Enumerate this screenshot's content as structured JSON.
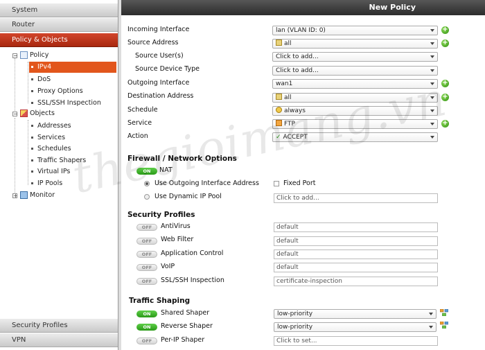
{
  "sidebar": {
    "headers": [
      "System",
      "Router",
      "Policy & Objects"
    ],
    "footer": [
      "Security Profiles",
      "VPN"
    ],
    "tree": {
      "policy": "Policy",
      "ipv4": "IPv4",
      "dos": "DoS",
      "proxy_options": "Proxy Options",
      "ssl_ssh": "SSL/SSH Inspection",
      "objects": "Objects",
      "addresses": "Addresses",
      "services": "Services",
      "schedules": "Schedules",
      "traffic_shapers": "Traffic Shapers",
      "virtual_ips": "Virtual IPs",
      "ip_pools": "IP Pools",
      "monitor": "Monitor"
    }
  },
  "main": {
    "title": "New Policy",
    "fields": {
      "incoming_interface": {
        "label": "Incoming Interface",
        "value": "lan (VLAN ID: 0)"
      },
      "source_address": {
        "label": "Source Address",
        "value": "all"
      },
      "source_users": {
        "label": "Source User(s)",
        "value": "Click to add..."
      },
      "source_device_type": {
        "label": "Source Device Type",
        "value": "Click to add..."
      },
      "outgoing_interface": {
        "label": "Outgoing Interface",
        "value": "wan1"
      },
      "destination_address": {
        "label": "Destination Address",
        "value": "all"
      },
      "schedule": {
        "label": "Schedule",
        "value": "always"
      },
      "service": {
        "label": "Service",
        "value": "FTP"
      },
      "action": {
        "label": "Action",
        "value": "ACCEPT"
      }
    },
    "firewall": {
      "heading": "Firewall / Network Options",
      "nat_label": "NAT",
      "nat_state": "ON",
      "use_outgoing": "Use Outgoing Interface Address",
      "fixed_port": "Fixed Port",
      "use_dynamic": "Use Dynamic IP Pool",
      "dynamic_placeholder": "Click to add..."
    },
    "security": {
      "heading": "Security Profiles",
      "items": [
        {
          "label": "AntiVirus",
          "state": "OFF",
          "value": "default"
        },
        {
          "label": "Web Filter",
          "state": "OFF",
          "value": "default"
        },
        {
          "label": "Application Control",
          "state": "OFF",
          "value": "default"
        },
        {
          "label": "VoIP",
          "state": "OFF",
          "value": "default"
        },
        {
          "label": "SSL/SSH Inspection",
          "state": "OFF",
          "value": "certificate-inspection"
        }
      ]
    },
    "shaping": {
      "heading": "Traffic Shaping",
      "shared": {
        "label": "Shared Shaper",
        "state": "ON",
        "value": "low-priority"
      },
      "reverse": {
        "label": "Reverse Shaper",
        "state": "ON",
        "value": "low-priority"
      },
      "perip": {
        "label": "Per-IP Shaper",
        "state": "OFF",
        "value": "Click to set..."
      }
    }
  },
  "watermark": "thegioimang.vn",
  "colors": {
    "accent": "#e2561c",
    "active_nav": "#c0371c",
    "toggle_on": "#3cad27"
  }
}
